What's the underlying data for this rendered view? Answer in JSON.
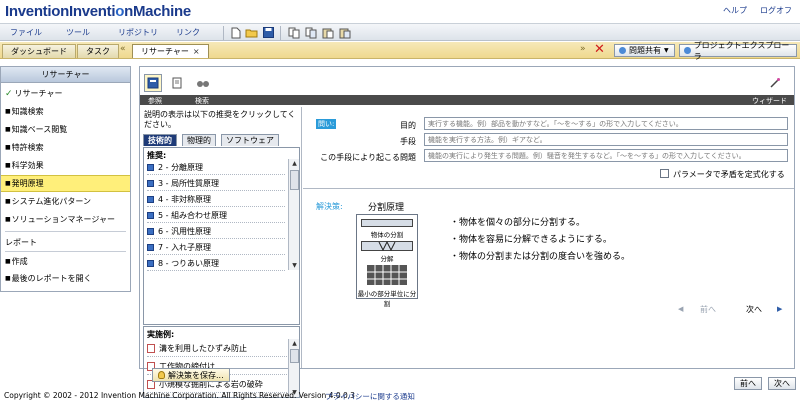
{
  "header": {
    "logo_main": "Invention",
    "logo_o": "o",
    "logo_tail": "n",
    "logo_suffix": "Machine",
    "help": "ヘルプ",
    "logout": "ログオフ"
  },
  "menu": {
    "items": [
      "ファイル",
      "ツール",
      "リポジトリ",
      "リンク"
    ]
  },
  "tabs": {
    "dashboard": "ダッシュボード",
    "task": "タスク",
    "researcher": "リサーチャー",
    "close": "×",
    "share": "問題共有",
    "project_explorer": "プロジェクトエクスプローラ"
  },
  "leftnav": {
    "title": "リサーチャー",
    "items": [
      {
        "label": "リサーチャー",
        "mark": "✓"
      },
      {
        "label": "知識検索"
      },
      {
        "label": "知識ベース閲覧"
      },
      {
        "label": "特許検索"
      },
      {
        "label": "科学効果"
      },
      {
        "label": "発明原理"
      },
      {
        "label": "システム進化パターン"
      },
      {
        "label": "ソリューションマネージャー"
      }
    ],
    "report_title": "レポート",
    "report_items": [
      {
        "label": "作成"
      },
      {
        "label": "最後のレポートを開く"
      }
    ]
  },
  "main": {
    "strip": {
      "ref": "参照",
      "search": "検索",
      "wizard": "ウィザード"
    },
    "description": "説明の表示は以下の推奨をクリックしてください。",
    "subtabs": [
      "技術的",
      "物理的",
      "ソフトウェア"
    ],
    "recommendations_label": "推奨:",
    "principles": [
      "2 - 分離原理",
      "3 - 局所性質原理",
      "4 - 非対称原理",
      "5 - 組み合わせ原理",
      "6 - 汎用性原理",
      "7 - 入れ子原理",
      "8 - つりあい原理"
    ],
    "examples_label": "実施例:",
    "examples": [
      "溝を利用したひずみ防止",
      "工作物の締付け",
      "小規模な掘削による岩の破砕"
    ],
    "question_badge": "問い:",
    "form": {
      "purpose_label": "目的",
      "purpose_placeholder": "実行する機能。例）部品を動かすなど。「～を～する」の形で入力してください。",
      "means_label": "手段",
      "means_placeholder": "機能を実行する方法。例）ギアなど。",
      "problem_label": "この手段により起こる問題",
      "problem_placeholder": "機能の実行により発生する問題。例）騒音を発生するなど。「～を～する」の形で入力してください。",
      "param_label": "パラメータで矛盾を定式化する"
    },
    "solution": {
      "label": "解決策:",
      "title": "分割原理",
      "diagram_top": "物体の分割",
      "diagram_mid": "分解",
      "diagram_bottom": "最小の部分単位に分割",
      "bullets": [
        "・物体を個々の部分に分割する。",
        "・物体を容易に分解できるようにする。",
        "・物体の分割または分割の度合いを強める。"
      ],
      "prev": "前へ",
      "next": "次へ"
    }
  },
  "bottom": {
    "save": "解決策を保存...",
    "copyright": "Copyright © 2002 - 2012 Invention Machine Corporation. All Rights Reserved. Version 4.0.0.3",
    "privacy": "プライバシーに関する通知",
    "prev": "前へ",
    "next": "次へ"
  }
}
